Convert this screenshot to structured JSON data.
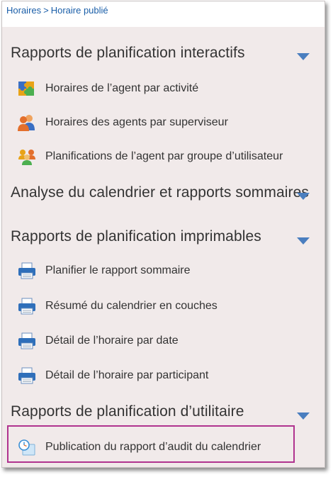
{
  "breadcrumb": {
    "items": [
      "Horaires",
      "Horaire publié"
    ],
    "separator": ">"
  },
  "sections": [
    {
      "title": "Rapports de planification interactifs",
      "items": [
        {
          "label": "Horaires de l’agent par activité",
          "icon": "puzzle-icon"
        },
        {
          "label": "Horaires des agents par superviseur",
          "icon": "supervisor-people-icon"
        },
        {
          "label": "Planifications de l’agent par groupe d’utilisateur",
          "icon": "user-group-icon"
        }
      ]
    },
    {
      "title": "Analyse du calendrier et rapports sommaires",
      "items": []
    },
    {
      "title": "Rapports de planification imprimables",
      "items": [
        {
          "label": "Planifier le rapport sommaire",
          "icon": "printer-icon"
        },
        {
          "label": "Résumé du calendrier en couches",
          "icon": "printer-icon"
        },
        {
          "label": "Détail de l’horaire par date",
          "icon": "printer-icon"
        },
        {
          "label": "Détail de l’horaire par participant",
          "icon": "printer-icon"
        }
      ]
    },
    {
      "title": "Rapports de planification d’utilitaire",
      "items": [
        {
          "label": "Publication du rapport d’audit du calendrier",
          "icon": "audit-clock-icon",
          "highlighted": true
        }
      ]
    }
  ],
  "colors": {
    "panel_bg": "#f1eaea",
    "link": "#1a5ea8",
    "caret": "#4a7ebf",
    "highlight_border": "#b0338f"
  }
}
